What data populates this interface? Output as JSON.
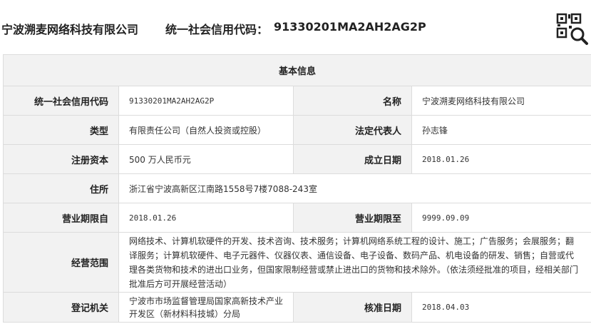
{
  "header": {
    "company_name": "宁波溯麦网络科技有限公司",
    "credit_label": "统一社会信用代码：",
    "credit_code": "91330201MA2AH2AG2P"
  },
  "table": {
    "title": "基本信息",
    "credit_code_label": "统一社会信用代码",
    "credit_code_value": "91330201MA2AH2AG2P",
    "name_label": "名称",
    "name_value": "宁波溯麦网络科技有限公司",
    "type_label": "类型",
    "type_value": "有限责任公司（自然人投资或控股）",
    "legal_rep_label": "法定代表人",
    "legal_rep_value": "孙志锋",
    "capital_label": "注册资本",
    "capital_value": "500 万人民币元",
    "established_label": "成立日期",
    "established_value": "2018.01.26",
    "address_label": "住所",
    "address_value": "浙江省宁波高新区江南路1558号7楼7088-243室",
    "term_from_label": "营业期限自",
    "term_from_value": "2018.01.26",
    "term_to_label": "营业期限至",
    "term_to_value": "9999.09.09",
    "scope_label": "经营范围",
    "scope_value": "网络技术、计算机软硬件的开发、技术咨询、技术服务；计算机网络系统工程的设计、施工；广告服务；会展服务；翻译服务；计算机软硬件、电子元器件、仪器仪表、通信设备、电子设备、数码产品、机电设备的研发、销售；自营或代理各类货物和技术的进出口业务，但国家限制经营或禁止进出口的货物和技术除外。（依法须经批准的项目，经相关部门批准后方可开展经营活动）",
    "authority_label": "登记机关",
    "authority_value": "宁波市市场监督管理局国家高新技术产业开发区（新材料科技城）分局",
    "approval_label": "核准日期",
    "approval_value": "2018.04.03"
  },
  "icons": {
    "qr": "qr-search-icon"
  }
}
